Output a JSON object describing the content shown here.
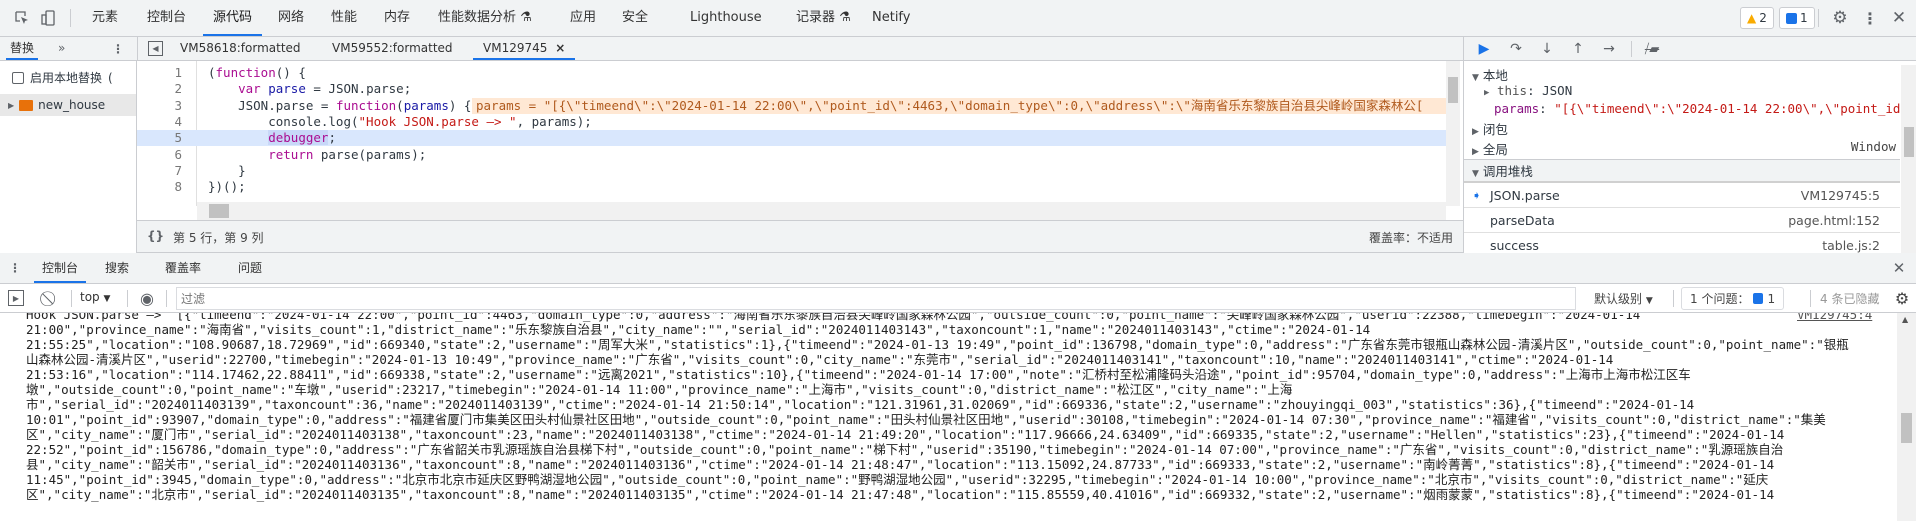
{
  "topbar": {
    "tabs": [
      "元素",
      "控制台",
      "源代码",
      "网络",
      "性能",
      "内存",
      "性能数据分析",
      "应用",
      "安全",
      "Lighthouse",
      "记录器",
      "Netify"
    ],
    "active_tab": "源代码",
    "warnings_count": "2",
    "messages_count": "1"
  },
  "navigator": {
    "tab": "替换",
    "more": "»",
    "enable_local_overrides": "启用本地替换",
    "paren": "(",
    "folder": "new_house"
  },
  "editor": {
    "tabs": [
      "VM58618:formatted",
      "VM59552:formatted",
      "VM129745"
    ],
    "active_tab": "VM129745",
    "close": "×",
    "lines": [
      [
        [
          "(",
          "p"
        ],
        [
          "function",
          "kw"
        ],
        [
          "() {",
          "p"
        ]
      ],
      [
        [
          "    ",
          "p"
        ],
        [
          "var",
          "kw"
        ],
        [
          " ",
          "p"
        ],
        [
          "parse",
          "vn"
        ],
        [
          " = JSON.parse;",
          "p"
        ]
      ],
      [
        [
          "    JSON.parse = ",
          "p"
        ],
        [
          "function",
          "kw"
        ],
        [
          "(",
          "p"
        ],
        [
          "params",
          "vn"
        ],
        [
          ") {",
          "p"
        ]
      ],
      [
        [
          "        console.log(",
          "p"
        ],
        [
          "\"Hook JSON.parse —> \"",
          "str"
        ],
        [
          ", params);",
          "p"
        ]
      ],
      [
        [
          "        ",
          "p"
        ],
        [
          "debugger",
          "kw"
        ],
        [
          ";",
          "p"
        ]
      ],
      [
        [
          "        ",
          "p"
        ],
        [
          "return",
          "kw"
        ],
        [
          " parse(params);",
          "p"
        ]
      ],
      [
        [
          "    }",
          "p"
        ]
      ],
      [
        [
          "})();",
          "p"
        ]
      ]
    ],
    "inline_value": "params = \"[{\\\"timeend\\\":\\\"2024-01-14 22:00\\\",\\\"point_id\\\":4463,\\\"domain_type\\\":0,\\\"address\\\":\\\"海南省乐东黎族自治县尖峰岭国家森林公[",
    "paused_line": 5,
    "status_position": "第 5 行，第 9 列",
    "status_coverage": "覆盖率：不适用",
    "pretty_print": "{}"
  },
  "debugger": {
    "scope_local": "本地",
    "this_label": "this",
    "this_value": "JSON",
    "params_label": "params",
    "params_value": "\"[{\\\"timeend\\\":\\\"2024-01-14 22:00\\\",\\\"point_id\\",
    "scope_closure": "闭包",
    "scope_global": "全局",
    "global_value": "Window",
    "call_stack": "调用堆栈",
    "frames": [
      {
        "name": "JSON.parse",
        "loc": "VM129745:5"
      },
      {
        "name": "parseData",
        "loc": "page.html:152"
      },
      {
        "name": "success",
        "loc": "table.js:2"
      }
    ]
  },
  "drawer": {
    "tabs": [
      "控制台",
      "搜索",
      "覆盖率",
      "问题"
    ],
    "active_tab": "控制台"
  },
  "console_toolbar": {
    "context": "top",
    "filter_placeholder": "过滤",
    "level": "默认级别",
    "issues_label": "1 个问题：",
    "issues_count": "1",
    "hidden": "4 条已隐藏"
  },
  "console": {
    "source_link": "VM129745:4",
    "lines": [
      "Hook JSON.parse —>  [{\"timeend\":\"2024-01-14 22:00\",\"point_id\":4463,\"domain_type\":0,\"address\":\"海南省乐东黎族自治县尖峰岭国家森林公园\",\"outside_count\":0,\"point_name\":\"尖峰岭国家森林公园\",\"userid\":22388,\"timebegin\":\"2024-01-14",
      "21:00\",\"province_name\":\"海南省\",\"visits_count\":1,\"district_name\":\"乐东黎族自治县\",\"city_name\":\"\",\"serial_id\":\"2024011403143\",\"taxoncount\":1,\"name\":\"2024011403143\",\"ctime\":\"2024-01-14",
      "21:55:25\",\"location\":\"108.90687,18.72969\",\"id\":669340,\"state\":2,\"username\":\"周军大米\",\"statistics\":1},{\"timeend\":\"2024-01-13 19:49\",\"point_id\":136798,\"domain_type\":0,\"address\":\"广东省东莞市银瓶山森林公园-清溪片区\",\"outside_count\":0,\"point_name\":\"银瓶",
      "山森林公园-清溪片区\",\"userid\":22700,\"timebegin\":\"2024-01-13 10:49\",\"province_name\":\"广东省\",\"visits_count\":0,\"city_name\":\"东莞市\",\"serial_id\":\"2024011403141\",\"taxoncount\":10,\"name\":\"2024011403141\",\"ctime\":\"2024-01-14",
      "21:53:16\",\"location\":\"114.17462,22.88411\",\"id\":669338,\"state\":2,\"username\":\"远离2021\",\"statistics\":10},{\"timeend\":\"2024-01-14 17:00\",\"note\":\"汇桥村至松浦隆码头沿途\",\"point_id\":95704,\"domain_type\":0,\"address\":\"上海市上海市松江区车",
      "墩\",\"outside_count\":0,\"point_name\":\"车墩\",\"userid\":23217,\"timebegin\":\"2024-01-14 11:00\",\"province_name\":\"上海市\",\"visits_count\":0,\"district_name\":\"松江区\",\"city_name\":\"上海",
      "市\",\"serial_id\":\"2024011403139\",\"taxoncount\":36,\"name\":\"2024011403139\",\"ctime\":\"2024-01-14 21:50:14\",\"location\":\"121.31961,31.02069\",\"id\":669336,\"state\":2,\"username\":\"zhouyingqi_003\",\"statistics\":36},{\"timeend\":\"2024-01-14",
      "10:01\",\"point_id\":93907,\"domain_type\":0,\"address\":\"福建省厦门市集美区田头村仙景社区田地\",\"outside_count\":0,\"point_name\":\"田头村仙景社区田地\",\"userid\":30108,\"timebegin\":\"2024-01-14 07:30\",\"province_name\":\"福建省\",\"visits_count\":0,\"district_name\":\"集美",
      "区\",\"city_name\":\"厦门市\",\"serial_id\":\"2024011403138\",\"taxoncount\":23,\"name\":\"2024011403138\",\"ctime\":\"2024-01-14 21:49:20\",\"location\":\"117.96666,24.63409\",\"id\":669335,\"state\":2,\"username\":\"Hellen\",\"statistics\":23},{\"timeend\":\"2024-01-14",
      "22:52\",\"point_id\":156786,\"domain_type\":0,\"address\":\"广东省韶关市乳源瑶族自治县梯下村\",\"outside_count\":0,\"point_name\":\"梯下村\",\"userid\":35190,\"timebegin\":\"2024-01-14 07:00\",\"province_name\":\"广东省\",\"visits_count\":0,\"district_name\":\"乳源瑶族自治",
      "县\",\"city_name\":\"韶关市\",\"serial_id\":\"2024011403136\",\"taxoncount\":8,\"name\":\"2024011403136\",\"ctime\":\"2024-01-14 21:48:47\",\"location\":\"113.15092,24.87733\",\"id\":669333,\"state\":2,\"username\":\"南岭菁菁\",\"statistics\":8},{\"timeend\":\"2024-01-14",
      "11:45\",\"point_id\":3945,\"domain_type\":0,\"address\":\"北京市北京市延庆区野鸭湖湿地公园\",\"outside_count\":0,\"point_name\":\"野鸭湖湿地公园\",\"userid\":32295,\"timebegin\":\"2024-01-14 10:00\",\"province_name\":\"北京市\",\"visits_count\":0,\"district_name\":\"延庆",
      "区\",\"city_name\":\"北京市\",\"serial_id\":\"2024011403135\",\"taxoncount\":8,\"name\":\"2024011403135\",\"ctime\":\"2024-01-14 21:47:48\",\"location\":\"115.85559,40.41016\",\"id\":669332,\"state\":2,\"username\":\"烟雨蒙蒙\",\"statistics\":8},{\"timeend\":\"2024-01-14"
    ]
  },
  "colors": {
    "accent": "#1a73e8",
    "warning": "#f9ab00",
    "paused_line": "#d9e7fd",
    "inline_value_bg": "#ffe8d4"
  }
}
